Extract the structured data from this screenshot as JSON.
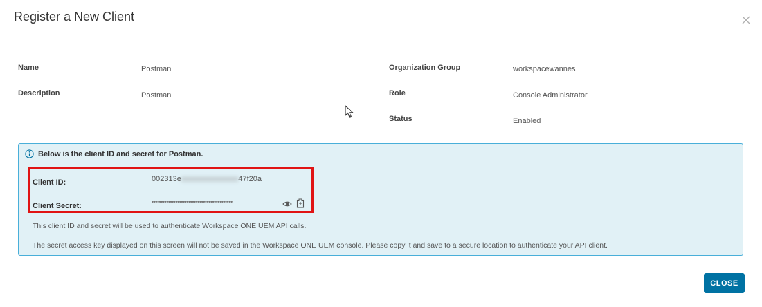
{
  "dialog": {
    "title": "Register a New Client"
  },
  "client_info": {
    "name_label": "Name",
    "name_value": "Postman",
    "description_label": "Description",
    "description_value": "Postman",
    "org_group_label": "Organization Group",
    "org_group_value": "workspacewannes",
    "role_label": "Role",
    "role_value": "Console Administrator",
    "status_label": "Status",
    "status_value": "Enabled"
  },
  "credentials": {
    "heading": "Below is the client ID and secret for Postman.",
    "client_id_label": "Client ID:",
    "client_id_visible_start": "002313e",
    "client_id_blurred": "xxxxxxxxxxxxxxx",
    "client_id_visible_end": "47f20a",
    "client_secret_label": "Client Secret:",
    "client_secret_masked": "••••••••••••••••••••••••••••••••••••••••••••",
    "note_1": "This client ID and secret will be used to authenticate Workspace ONE UEM API calls.",
    "note_2": "The secret access key displayed on this screen will not be saved in the Workspace ONE UEM console. Please copy it and save to a secure location to authenticate your API client."
  },
  "footer": {
    "close_label": "CLOSE"
  },
  "icons": {
    "close": "close-icon",
    "info": "info-circle-icon",
    "show_secret": "eye-icon",
    "copy_secret": "clipboard-icon",
    "pointer": "mouse-pointer-icon"
  },
  "colors": {
    "primary_button": "#0072a3",
    "info_panel_bg": "#e1f1f6",
    "info_panel_border": "#49afd9",
    "highlight": "#e01414"
  }
}
